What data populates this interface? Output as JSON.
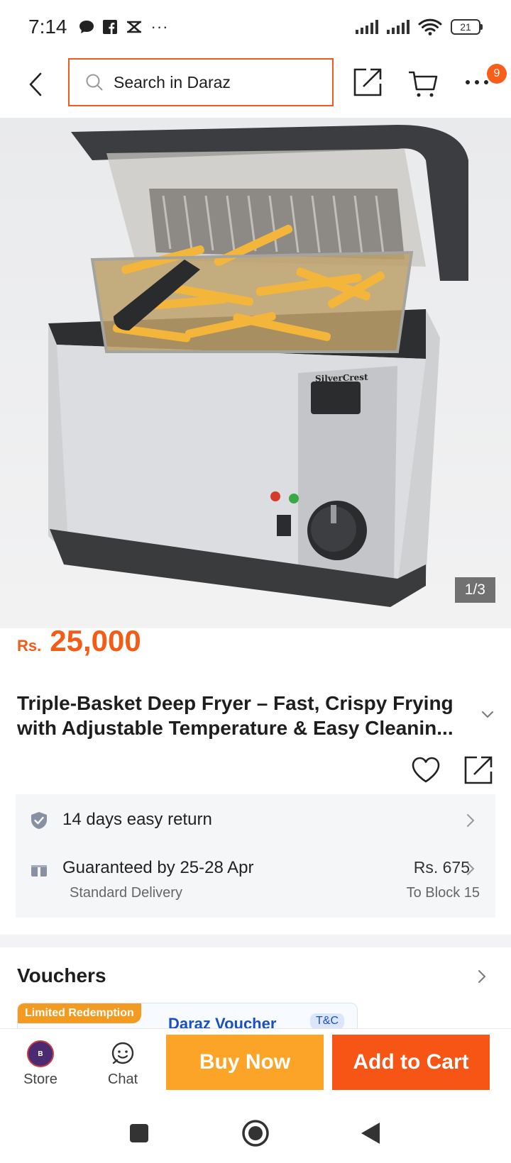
{
  "status_bar": {
    "time": "7:14",
    "left_icons": [
      "chat-bubble-icon",
      "facebook-icon",
      "tiktok-icon",
      "more-notifications-icon"
    ],
    "overflow_dots": "···",
    "battery_level": "21"
  },
  "header": {
    "search_placeholder": "Search in Daraz",
    "more_badge": "9"
  },
  "product": {
    "image_counter": "1/3",
    "image_brand": "SilverCrest",
    "price_currency": "Rs.",
    "price_value": "25,000",
    "title": "Triple-Basket Deep Fryer – Fast, Crispy Frying with Adjustable Temperature & Easy Cleanin..."
  },
  "service": {
    "return_text": "14 days easy return",
    "delivery_text": "Guaranteed by 25-28 Apr",
    "delivery_type": "Standard Delivery",
    "shipping_fee": "Rs. 675",
    "ship_to": "To Block 15"
  },
  "vouchers": {
    "title": "Vouchers",
    "limited_tag": "Limited Redemption",
    "voucher_name": "Daraz Voucher",
    "tc": "T&C"
  },
  "action_bar": {
    "store_label": "Store",
    "chat_label": "Chat",
    "buy_now": "Buy Now",
    "add_to_cart": "Add to Cart"
  },
  "colors": {
    "accent_orange": "#f35b16",
    "buy_now_bg": "#fba427",
    "add_to_cart_bg": "#f75515",
    "search_border": "#f05a1e"
  }
}
